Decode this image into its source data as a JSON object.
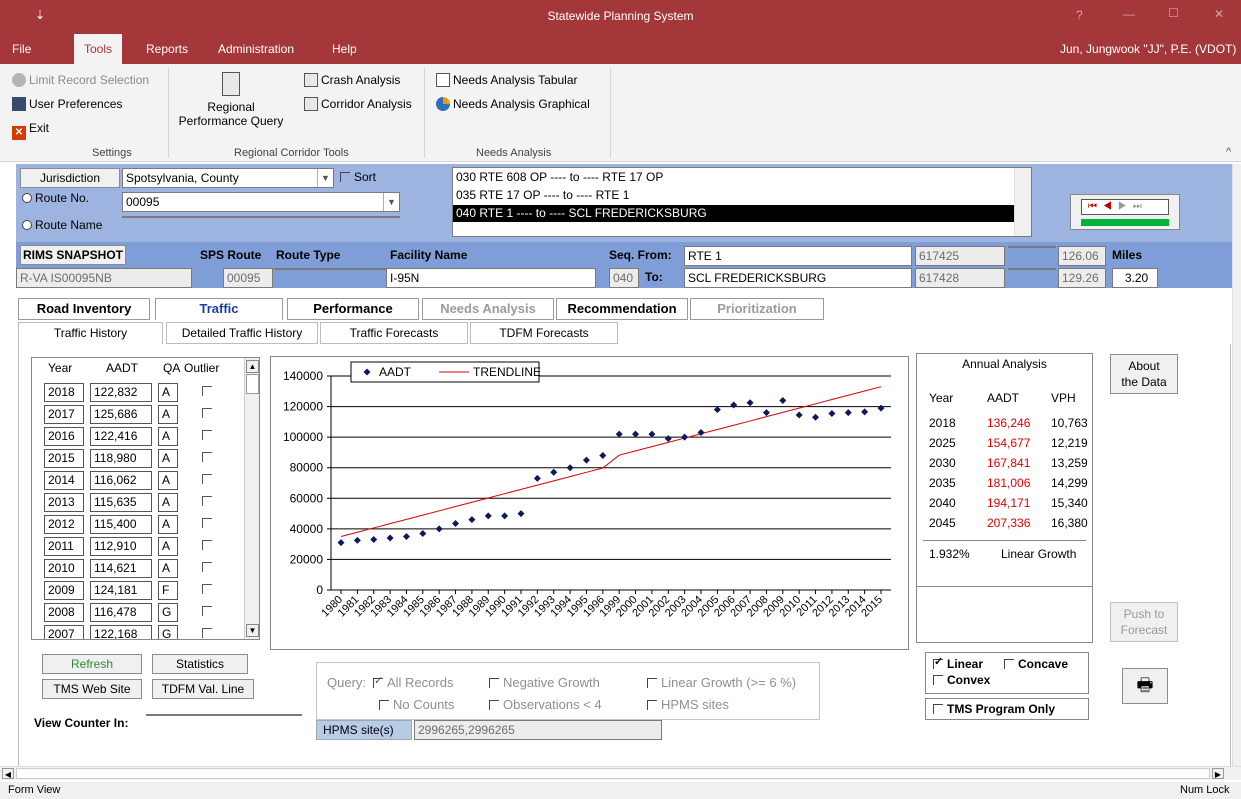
{
  "window": {
    "title": "Statewide Planning System",
    "help": "?",
    "minimize": "—",
    "maximize": "☐",
    "close": "✕",
    "qat": "⇣"
  },
  "menu": {
    "items": [
      "File",
      "Tools",
      "Reports",
      "Administration",
      "Help"
    ],
    "active": "Tools",
    "user": "Jun, Jungwook \"JJ\", P.E. (VDOT)"
  },
  "ribbon": {
    "limit": "Limit Record Selection",
    "prefs": "User Preferences",
    "exit": "Exit",
    "settings_group": "Settings",
    "regional_line1": "Regional",
    "regional_line2": "Performance Query",
    "crash": "Crash Analysis",
    "corridor": "Corridor Analysis",
    "rct_group": "Regional Corridor Tools",
    "tabular": "Needs Analysis Tabular",
    "graphical": "Needs Analysis Graphical",
    "needs_group": "Needs Analysis",
    "collapse": "^"
  },
  "selection": {
    "jurisdiction_btn": "Jurisdiction",
    "jurisdiction": "Spotsylvania, County",
    "sort": "Sort",
    "route_no": "Route No.",
    "route_no_value": "00095",
    "route_name": "Route Name",
    "route_name_value": "",
    "segments": [
      "030  RTE 608 OP ---- to ---- RTE 17 OP",
      "035  RTE 17 OP ---- to ---- RTE 1",
      "040  RTE 1 ---- to ---- SCL FREDERICKSBURG"
    ],
    "selected_segment": 2
  },
  "nav": {
    "first": "⏮",
    "prev": "◀",
    "next": "▶",
    "last": "⏭"
  },
  "facility": {
    "rims_btn": "RIMS SNAPSHOT",
    "sps_label": "SPS Route",
    "route_type_label": "Route Type",
    "facility_label": "Facility Name",
    "seq_from_label": "Seq. From:",
    "to_label": "To:",
    "miles_label": "Miles",
    "rims_value": "R-VA   IS00095NB",
    "sps_value": "00095",
    "route_type_value": "",
    "facility_value": "I-95N",
    "seq": "040",
    "from_value": "RTE 1",
    "to_value": "SCL FREDERICKSBURG",
    "from_code": "617425",
    "to_code": "617428",
    "from_mile": "126.06",
    "to_mile": "129.26",
    "miles": "3.20"
  },
  "tabs": [
    "Road Inventory",
    "Traffic",
    "Performance",
    "Needs Analysis",
    "Recommendation",
    "Prioritization"
  ],
  "subtabs": [
    "Traffic History",
    "Detailed Traffic History",
    "Traffic Forecasts",
    "TDFM Forecasts"
  ],
  "history": {
    "headers": [
      "Year",
      "AADT",
      "QA",
      "Outlier"
    ],
    "rows": [
      [
        "2018",
        "122,832",
        "A"
      ],
      [
        "2017",
        "125,686",
        "A"
      ],
      [
        "2016",
        "122,416",
        "A"
      ],
      [
        "2015",
        "118,980",
        "A"
      ],
      [
        "2014",
        "116,062",
        "A"
      ],
      [
        "2013",
        "115,635",
        "A"
      ],
      [
        "2012",
        "115,400",
        "A"
      ],
      [
        "2011",
        "112,910",
        "A"
      ],
      [
        "2010",
        "114,621",
        "A"
      ],
      [
        "2009",
        "124,181",
        "F"
      ],
      [
        "2008",
        "116,478",
        "G"
      ],
      [
        "2007",
        "122,168",
        "G"
      ]
    ]
  },
  "chart_data": {
    "type": "scatter",
    "title": "",
    "xlabel": "",
    "ylabel": "",
    "ylim": [
      0,
      140000
    ],
    "yticks": [
      "140000",
      "120000",
      "100000",
      "80000",
      "60000",
      "40000",
      "20000",
      "0"
    ],
    "x": [
      "1980",
      "1981",
      "1982",
      "1983",
      "1984",
      "1985",
      "1986",
      "1987",
      "1988",
      "1989",
      "1990",
      "1991",
      "1992",
      "1993",
      "1994",
      "1995",
      "1996",
      "1999",
      "2000",
      "2001",
      "2002",
      "2003",
      "2004",
      "2005",
      "2006",
      "2007",
      "2008",
      "2009",
      "2010",
      "2011",
      "2012",
      "2013",
      "2014",
      "2015"
    ],
    "series": [
      {
        "name": "AADT",
        "values": [
          31000,
          32500,
          33000,
          34000,
          35000,
          37000,
          40000,
          43500,
          46000,
          48500,
          48500,
          50000,
          73000,
          77000,
          80000,
          85000,
          88000,
          102000,
          102000,
          102000,
          99000,
          100000,
          103000,
          118000,
          121000,
          122500,
          116000,
          124000,
          114500,
          113000,
          115500,
          116000,
          116500,
          119000
        ]
      },
      {
        "name": "TRENDLINE",
        "values": [
          35000,
          37800,
          40600,
          43400,
          46200,
          49000,
          51800,
          54600,
          57400,
          60200,
          63000,
          65800,
          68600,
          71400,
          74200,
          77000,
          79800,
          88200,
          91000,
          93800,
          96600,
          99400,
          102200,
          105000,
          107800,
          110600,
          113400,
          116200,
          119000,
          121800,
          124600,
          127400,
          130200,
          133000
        ]
      }
    ],
    "legend": "top-left",
    "grid": true
  },
  "annual": {
    "title": "Annual Analysis",
    "headers": [
      "Year",
      "AADT",
      "VPH"
    ],
    "rows": [
      [
        "2018",
        "136,246",
        "10,763"
      ],
      [
        "2025",
        "154,677",
        "12,219"
      ],
      [
        "2030",
        "167,841",
        "13,259"
      ],
      [
        "2035",
        "181,006",
        "14,299"
      ],
      [
        "2040",
        "194,171",
        "15,340"
      ],
      [
        "2045",
        "207,336",
        "16,380"
      ]
    ],
    "growth_rate": "1.932%",
    "growth_type": "Linear Growth"
  },
  "about": {
    "line1": "About",
    "line2": "the Data"
  },
  "push": {
    "line1": "Push to",
    "line2": "Forecast"
  },
  "methods": {
    "linear": "Linear",
    "concave": "Concave",
    "convex": "Convex",
    "tms_only": "TMS Program Only"
  },
  "print_icon": "🖶",
  "actions": {
    "refresh": "Refresh",
    "statistics": "Statistics",
    "tms_web": "TMS Web Site",
    "tdfm": "TDFM Val. Line",
    "view_counter": "View Counter In:",
    "view_counter_value": ""
  },
  "query": {
    "label": "Query:",
    "all_records": "All Records",
    "negative": "Negative Growth",
    "linear": "Linear Growth (>= 6 %)",
    "no_counts": "No Counts",
    "obs": "Observations < 4",
    "hpms_sites": "HPMS sites",
    "hpms_label": "HPMS site(s)",
    "hpms_value": "2996265,2996265"
  },
  "status": {
    "left": "Form View",
    "right": "Num Lock"
  }
}
